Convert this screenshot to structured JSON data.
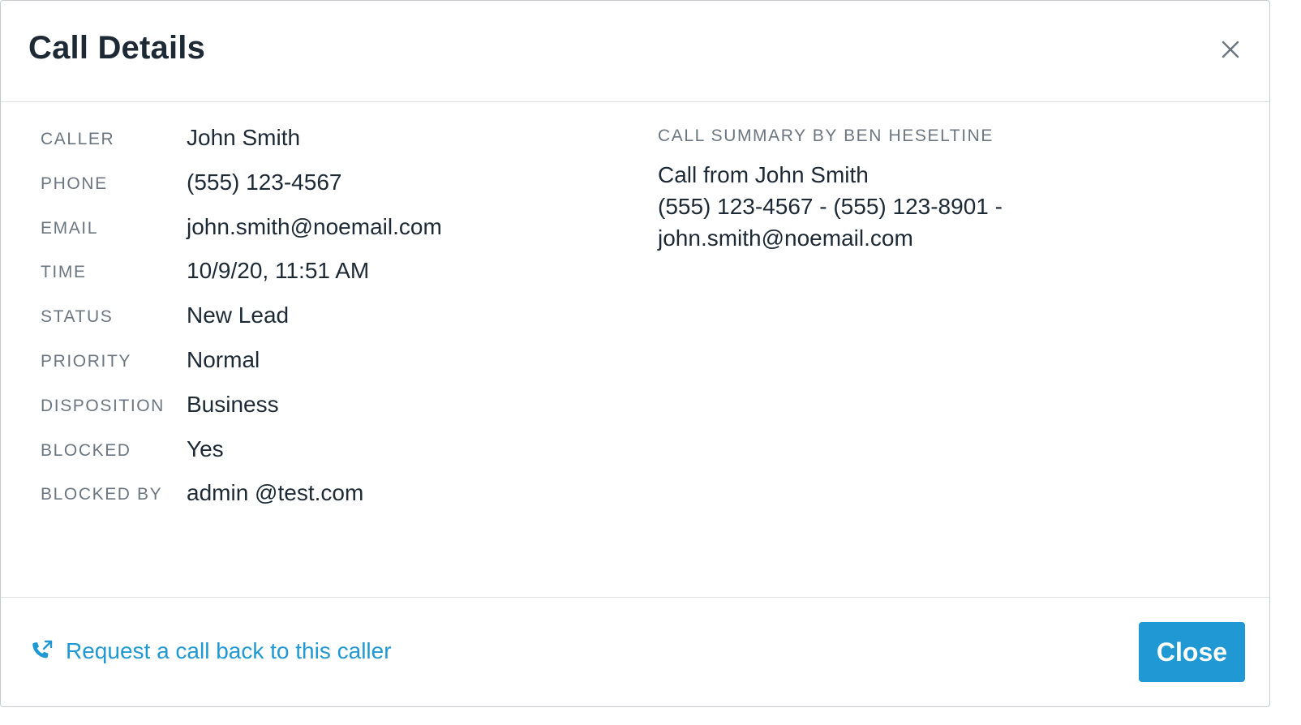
{
  "dialog": {
    "title": "Call Details",
    "close_icon": "close-icon"
  },
  "details": [
    {
      "label": "CALLER",
      "value": "John Smith"
    },
    {
      "label": "PHONE",
      "value": "(555) 123-4567"
    },
    {
      "label": "EMAIL",
      "value": "john.smith@noemail.com"
    },
    {
      "label": "TIME",
      "value": "10/9/20, 11:51 AM"
    },
    {
      "label": "STATUS",
      "value": "New Lead"
    },
    {
      "label": "PRIORITY",
      "value": "Normal"
    },
    {
      "label": "DISPOSITION",
      "value": "Business"
    },
    {
      "label": "BLOCKED",
      "value": "Yes"
    },
    {
      "label": "BLOCKED BY",
      "value": "admin @test.com"
    }
  ],
  "summary": {
    "heading": "CALL SUMMARY BY BEN HESELTINE",
    "lines": [
      "Call from John Smith",
      "(555) 123-4567 - (555) 123-8901 -",
      "john.smith@noemail.com"
    ]
  },
  "footer": {
    "callback_label": "Request a call back to this caller",
    "callback_icon": "phone-callback-icon",
    "close_label": "Close"
  },
  "colors": {
    "accent": "#1f98d3",
    "label": "#6b7680",
    "text": "#1d2a36",
    "divider": "#dde1e4"
  }
}
